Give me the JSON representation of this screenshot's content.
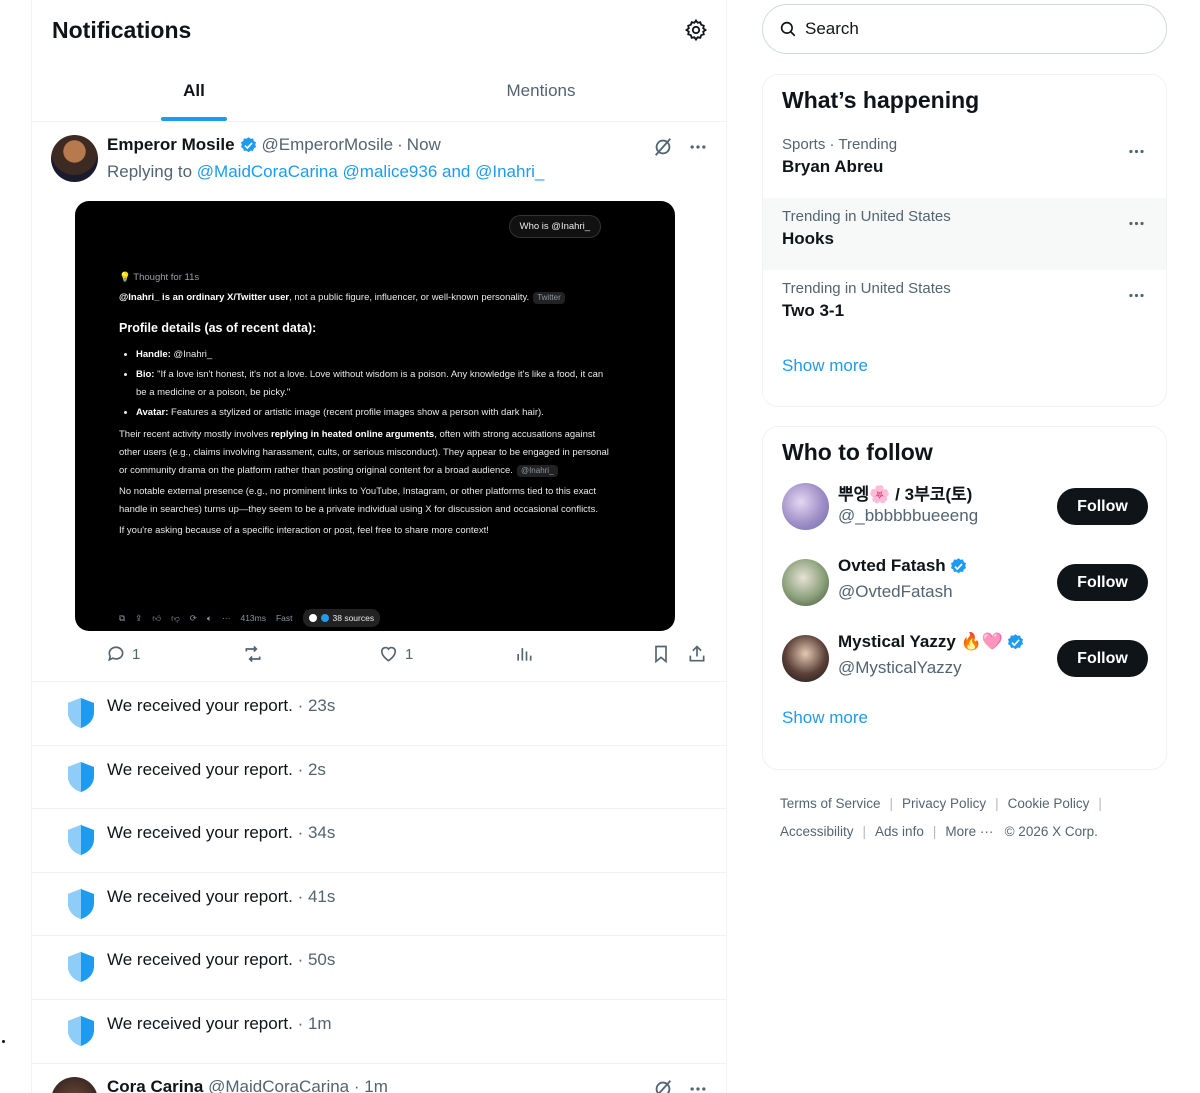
{
  "header": {
    "title": "Notifications"
  },
  "tabs": [
    {
      "label": "All"
    },
    {
      "label": "Mentions"
    }
  ],
  "tweet": {
    "name": "Emperor Mosile",
    "handle": "@EmperorMosile",
    "time_sep": "·",
    "time": "Now",
    "reply_prefix": "Replying to",
    "reply_to": "@MaidCoraCarina @malice936 and @Inahri_",
    "image": {
      "query": "Who is @Inahri_",
      "thought": "Thought for 11s",
      "intro_bold": "@Inahri_ is an ordinary X/Twitter user",
      "intro_rest": ", not a public figure, influencer, or well-known personality.",
      "intro_tag": "Twitter",
      "profile_heading": "Profile details (as of recent data):",
      "bullets": [
        {
          "label": "Handle:",
          "text": " @Inahri_"
        },
        {
          "label": "Bio:",
          "text": " \"If a love isn't honest, it's not a love. Love without wisdom is a poison. Any knowledge it's like a food, it can be a medicine or a poison, be picky.\""
        },
        {
          "label": "Avatar:",
          "text": " Features a stylized or artistic image (recent profile images show a person with dark hair)."
        }
      ],
      "activity_pre": "Their recent activity mostly involves ",
      "activity_bold": "replying in heated online arguments",
      "activity_post": ", often with strong accusations against other users (e.g., claims involving harassment, cults, or serious misconduct). They appear to be engaged in personal or community drama on the platform rather than posting original content for a broad audience.",
      "activity_tag": "@Inahri_",
      "presence": "No notable external presence (e.g., no prominent links to YouTube, Instagram, or other platforms tied to this exact handle in searches) turns up—they seem to be a private individual using X for discussion and occasional conflicts.",
      "closing": "If you're asking because of a specific interaction or post, feel free to share more context!",
      "footer_time": "413ms",
      "footer_mode": "Fast",
      "sources": "38 sources"
    },
    "actions": {
      "replies": "1",
      "likes": "1"
    }
  },
  "reports": [
    {
      "text": "We received your report.",
      "time": "· 23s"
    },
    {
      "text": "We received your report.",
      "time": "· 2s"
    },
    {
      "text": "We received your report.",
      "time": "· 34s"
    },
    {
      "text": "We received your report.",
      "time": "· 41s"
    },
    {
      "text": "We received your report.",
      "time": "· 50s"
    },
    {
      "text": "We received your report.",
      "time": "· 1m"
    }
  ],
  "tweet2": {
    "name": "Cora Carina",
    "handle": "@MaidCoraCarina",
    "time": "· 1m"
  },
  "search": {
    "placeholder": "Search"
  },
  "happening": {
    "title": "What’s happening",
    "trends": [
      {
        "meta": "Sports · Trending",
        "title": "Bryan Abreu"
      },
      {
        "meta": "Trending in United States",
        "title": "Hooks"
      },
      {
        "meta": "Trending in United States",
        "title": "Two 3-1"
      }
    ],
    "show_more": "Show more"
  },
  "who_to_follow": {
    "title": "Who to follow",
    "users": [
      {
        "name": "뿌엥🌸 / 3부코(토)",
        "handle": "@_bbbbbbueeeng",
        "button": "Follow"
      },
      {
        "name": "Ovted Fatash",
        "handle": "@OvtedFatash",
        "button": "Follow"
      },
      {
        "name": "Mystical Yazzy 🔥🩷",
        "handle": "@MysticalYazzy",
        "button": "Follow"
      }
    ],
    "show_more": "Show more"
  },
  "footer": {
    "terms": "Terms of Service",
    "privacy": "Privacy Policy",
    "cookie": "Cookie Policy",
    "accessibility": "Accessibility",
    "ads": "Ads info",
    "more": "More ···",
    "copyright": "© 2026 X Corp."
  },
  "colors": {
    "accent": "#1d9bf0",
    "text": "#0f1419",
    "muted": "#536471",
    "border": "#eff3f4"
  }
}
